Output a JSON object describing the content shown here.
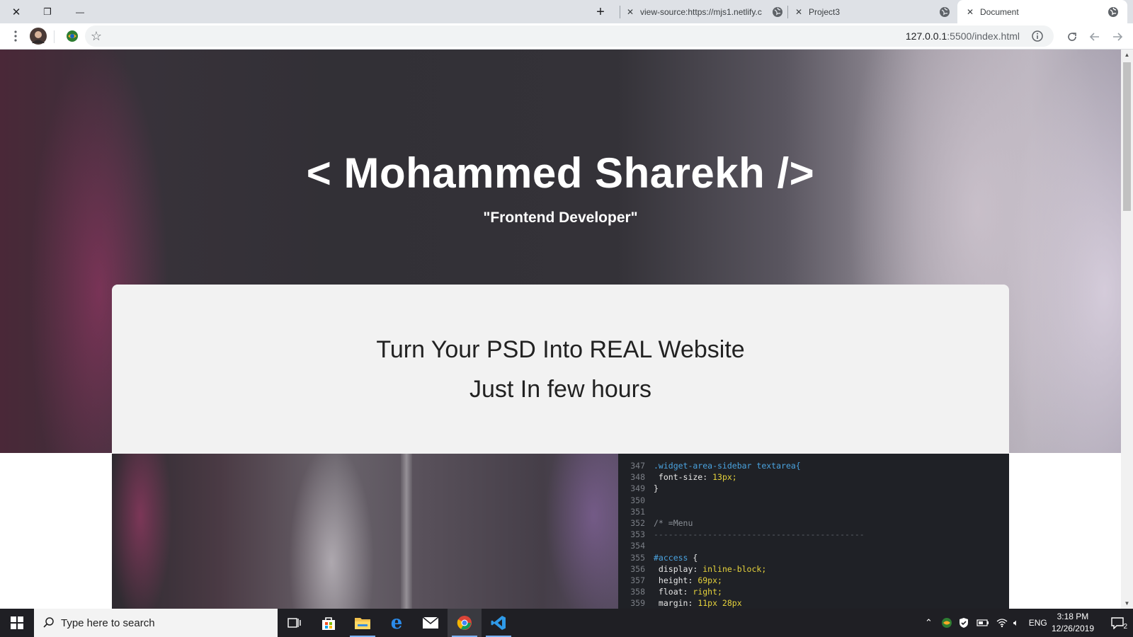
{
  "browser": {
    "window_buttons": {
      "close": "✕",
      "restore": "❐",
      "minimize": "—"
    },
    "new_tab": "+",
    "tabs": [
      {
        "title": "view-source:https://mjs1.netlify.c",
        "close": "✕",
        "active": false
      },
      {
        "title": "Project3",
        "close": "✕",
        "active": false
      },
      {
        "title": "Document",
        "close": "✕",
        "active": true
      }
    ],
    "omnibox": {
      "url_host": "127.0.0.1",
      "url_rest": ":5500/index.html"
    }
  },
  "page": {
    "hero": {
      "title": "< Mohammed Sharekh />",
      "subtitle": "\"Frontend Developer\""
    },
    "card": {
      "line1": "Turn Your PSD Into REAL Website",
      "line2": "Just In few hours"
    },
    "code_lines": [
      {
        "n": "347",
        "text": ".widget-area-sidebar",
        "cls": "c-sel",
        "extra": " textarea{",
        "extra_cls": "c-sel"
      },
      {
        "n": "348",
        "text": "    font-size: ",
        "cls": "c-prop",
        "extra": "13px;",
        "extra_cls": "c-val"
      },
      {
        "n": "349",
        "text": "}",
        "cls": "c-br",
        "extra": "",
        "extra_cls": ""
      },
      {
        "n": "350",
        "text": "",
        "cls": "",
        "extra": "",
        "extra_cls": ""
      },
      {
        "n": "351",
        "text": "",
        "cls": "",
        "extra": "",
        "extra_cls": ""
      },
      {
        "n": "352",
        "text": "/* =Menu",
        "cls": "c-cm",
        "extra": "",
        "extra_cls": ""
      },
      {
        "n": "353",
        "text": "-------------------------------------------",
        "cls": "dash",
        "extra": "",
        "extra_cls": ""
      },
      {
        "n": "354",
        "text": "",
        "cls": "",
        "extra": "",
        "extra_cls": ""
      },
      {
        "n": "355",
        "text": "#access",
        "cls": "c-sel",
        "extra": " {",
        "extra_cls": "c-br"
      },
      {
        "n": "356",
        "text": "    display: ",
        "cls": "c-prop",
        "extra": "inline-block;",
        "extra_cls": "c-val"
      },
      {
        "n": "357",
        "text": "    height: ",
        "cls": "c-prop",
        "extra": "69px;",
        "extra_cls": "c-val"
      },
      {
        "n": "358",
        "text": "    float: ",
        "cls": "c-prop",
        "extra": "right;",
        "extra_cls": "c-val"
      },
      {
        "n": "359",
        "text": "    margin: ",
        "cls": "c-prop",
        "extra": "11px 28px",
        "extra_cls": "c-val"
      }
    ]
  },
  "taskbar": {
    "search_placeholder": "Type here to search",
    "language": "ENG",
    "time": "3:18 PM",
    "date": "12/26/2019",
    "notification_count": "2"
  },
  "icons": {
    "close": "close-icon",
    "restore": "restore-icon",
    "minimize": "minimize-icon",
    "menu": "kebab-menu-icon",
    "profile": "avatar",
    "extension": "extension-icon",
    "bookmark": "star-icon",
    "info": "info-icon",
    "reload": "reload-icon",
    "back": "back-arrow-icon",
    "forward": "forward-arrow-icon"
  }
}
